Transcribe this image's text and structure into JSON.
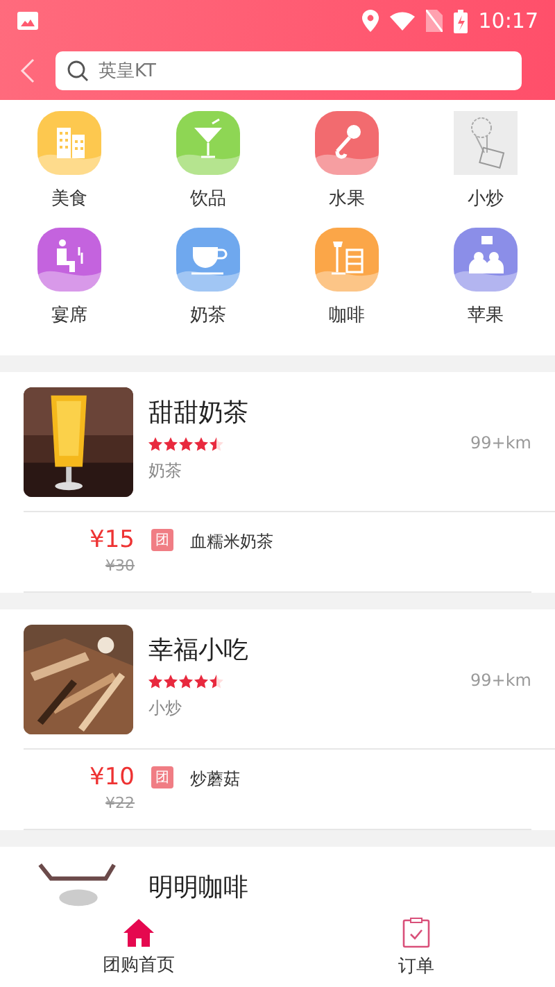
{
  "status_bar": {
    "time": "10:17"
  },
  "search": {
    "placeholder": "英皇KT"
  },
  "categories": [
    {
      "label": "美食",
      "kind": "building",
      "color": "#fdc84f"
    },
    {
      "label": "饮品",
      "kind": "cocktail",
      "color": "#8ed654"
    },
    {
      "label": "水果",
      "kind": "microphone",
      "color": "#f26b6f"
    },
    {
      "label": "小炒",
      "kind": "missing-image"
    },
    {
      "label": "宴席",
      "kind": "seat",
      "color": "#c463de"
    },
    {
      "label": "奶茶",
      "kind": "cup",
      "color": "#6fa8ee"
    },
    {
      "label": "咖啡",
      "kind": "lamp",
      "color": "#fba648"
    },
    {
      "label": "苹果",
      "kind": "people",
      "color": "#8b8ee8"
    }
  ],
  "shops": [
    {
      "name": "甜甜奶茶",
      "stars": 4.5,
      "distance": "99+km",
      "category": "奶茶",
      "price": "¥15",
      "old_price": "¥30",
      "deal_badge": "团",
      "deal": "血糯米奶茶"
    },
    {
      "name": "幸福小吃",
      "stars": 4.5,
      "distance": "99+km",
      "category": "小炒",
      "price": "¥10",
      "old_price": "¥22",
      "deal_badge": "团",
      "deal": "炒蘑菇"
    },
    {
      "name": "明明咖啡"
    }
  ],
  "bottom_nav": [
    {
      "label": "团购首页",
      "kind": "home",
      "selected": true
    },
    {
      "label": "订单",
      "kind": "orders",
      "selected": false
    }
  ]
}
